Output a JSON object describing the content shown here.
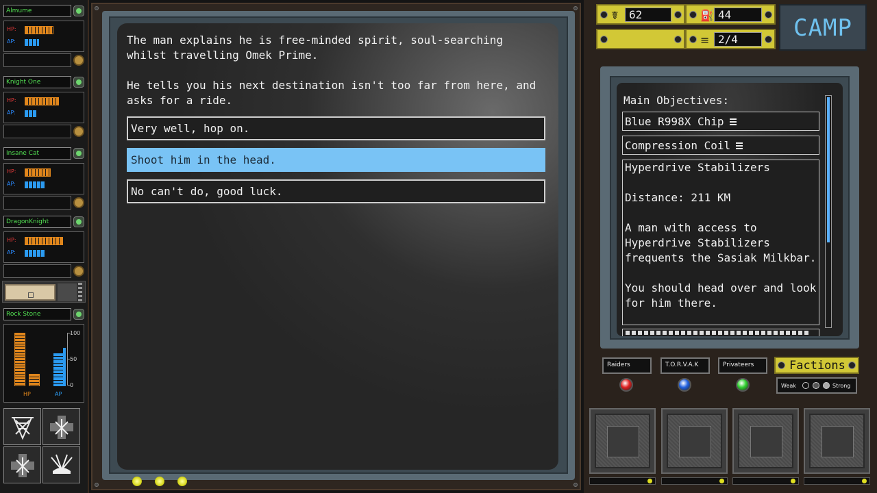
{
  "party": [
    {
      "name": "Almume",
      "hp_label": "HP:",
      "ap_label": "AP:",
      "hp_fill": 0.75,
      "ap_fill": 0.4
    },
    {
      "name": "Knight One",
      "hp_label": "HP:",
      "ap_label": "AP:",
      "hp_fill": 0.85,
      "ap_fill": 0.35
    },
    {
      "name": "Insane Cat",
      "hp_label": "HP:",
      "ap_label": "AP:",
      "hp_fill": 0.6,
      "ap_fill": 0.6
    },
    {
      "name": "DragonKnight",
      "hp_label": "HP:",
      "ap_label": "AP:",
      "hp_fill": 0.9,
      "ap_fill": 0.6
    }
  ],
  "rock_stone": {
    "name": "Rock Stone",
    "hp_axis": "HP",
    "ap_axis": "AP",
    "scale": [
      "100",
      "50",
      "0"
    ]
  },
  "abilities": [
    "net-ability-icon",
    "shield-ability-icon",
    "grab-ability-icon",
    "fan-ability-icon"
  ],
  "dialog": {
    "paragraphs": [
      "The man explains he is free-minded spirit, soul-searching whilst travelling Omek Prime.",
      "He tells you his next destination isn't too far from here, and asks for a ride."
    ],
    "choices": [
      "Very well, hop on.",
      "Shoot him in the head.",
      "No can't do, good luck."
    ]
  },
  "resources": {
    "res1": "62",
    "res2": "44",
    "res3": "",
    "res4": "2/4"
  },
  "camp_label": "CAMP",
  "objectives": {
    "title": "Main Objectives:",
    "items": [
      "Blue R998X Chip",
      "Compression Coil"
    ],
    "detail_title": "Hyperdrive Stabilizers",
    "detail_distance": "Distance: 211 KM",
    "detail_desc": "A man with access to Hyperdrive Stabilizers frequents the Sasiak Milkbar.",
    "detail_hint": "You should head over and look for him there."
  },
  "factions": {
    "names": [
      "Raiders",
      "T.O.R.V.A.K",
      "Privateers"
    ],
    "colors": [
      "#e02020",
      "#2060e0",
      "#30d030"
    ],
    "button_label": "Factions",
    "weak_label": "Weak",
    "strong_label": "Strong"
  },
  "colors": {
    "accent_blue": "#79c3f5",
    "hud_yellow": "#d2c836",
    "name_green": "#52e052"
  }
}
